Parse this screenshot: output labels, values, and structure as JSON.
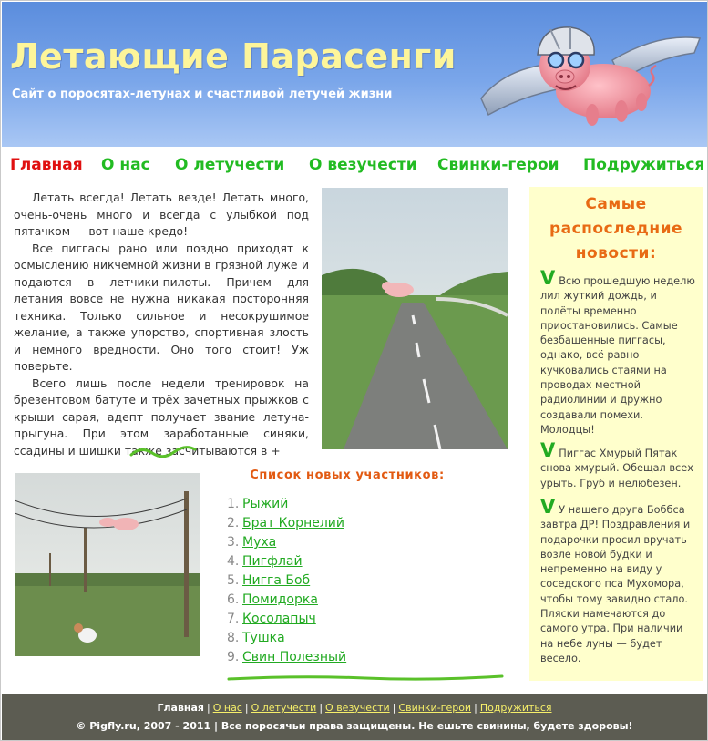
{
  "header": {
    "title": "Летающие Парасенги",
    "subtitle": "Сайт о поросятах-летунах и счастливой летучей жизни"
  },
  "nav": {
    "items": [
      {
        "label": "Главная",
        "active": true
      },
      {
        "label": "О нас",
        "active": false
      },
      {
        "label": "О летучести",
        "active": false
      },
      {
        "label": "О везучести",
        "active": false
      },
      {
        "label": "Свинки-герои",
        "active": false
      },
      {
        "label": "Подружиться",
        "active": false
      }
    ]
  },
  "intro": {
    "paragraphs": [
      "Летать всегда! Летать везде! Летать много, очень-очень много и всегда с улыбкой под пятачком — вот наше кредо!",
      "Все пиггасы рано или поздно приходят к осмыслению никчемной жизни в грязной луже и подаются в летчики-пилоты. Причем для летания вовсе не нужна никакая посторонняя техника. Только сильное и несокрушимое желание, а также упорство, спортивная злость и немного вредности. Оно того стоит! Уж поверьте.",
      "Всего лишь после недели тренировок на брезентовом батуте и трёх зачетных прыжков с крыши сарая, адепт получает звание летуна-прыгуна. При этом заработанные синяки, ссадины и шишки также засчитываются в +"
    ]
  },
  "members": {
    "title": "Список новых участников:",
    "items": [
      {
        "num": "1.",
        "name": "Рыжий"
      },
      {
        "num": "2.",
        "name": "Брат Корнелий"
      },
      {
        "num": "3.",
        "name": "Муха"
      },
      {
        "num": "4.",
        "name": "Пигфлай"
      },
      {
        "num": "5.",
        "name": "Нигга Боб"
      },
      {
        "num": "6.",
        "name": "Помидорка"
      },
      {
        "num": "7.",
        "name": "Косолапыч"
      },
      {
        "num": "8.",
        "name": "Тушка"
      },
      {
        "num": "9.",
        "name": "Свин Полезный"
      }
    ]
  },
  "news": {
    "title": "Самые распоследние новости:",
    "items": [
      {
        "mark": "V",
        "text": "Всю прошедшую неделю лил жуткий дождь, и полёты временно приостановились. Самые безбашенные пиггасы, однако, всё равно кучковались стаями на проводах местной радиолинии и дружно создавали помехи. Молодцы!"
      },
      {
        "mark": "V",
        "text": "Пиггас Хмурый Пятак снова хмурый. Обещал всех урыть. Груб и нелюбезен."
      },
      {
        "mark": "V",
        "text": "У нашего друга Боббса завтра ДР! Поздравления и подарочки просил вручать возле новой будки и непременно на виду у соседского пса Мухомора, чтобы тому завидно стало. Пляски намечаются до самого утра. При наличии на небе луны — будет весело."
      }
    ]
  },
  "footer": {
    "links": [
      {
        "label": "Главная",
        "current": true
      },
      {
        "label": "О нас",
        "current": false
      },
      {
        "label": "О летучести",
        "current": false
      },
      {
        "label": "О везучести",
        "current": false
      },
      {
        "label": "Свинки-герои",
        "current": false
      },
      {
        "label": "Подружиться",
        "current": false
      }
    ],
    "separator": "|",
    "copyright": "© Pigfly.ru, 2007 - 2011 | Все поросячьи права защищены. Не ешьте свинины, будете здоровы!"
  },
  "colors": {
    "header_bg": "#6f9ce6",
    "title": "#fdf59a",
    "nav_link": "#22bb22",
    "nav_active": "#e01010",
    "members_title": "#e25a12",
    "news_bg": "#ffffcc",
    "news_title": "#e86a14",
    "footer_bg": "#5c5c52",
    "footer_link": "#f6ef6a"
  },
  "icons": {
    "logo": "flying-pig-with-helmet-icon",
    "news_mark": "check-v-icon",
    "divider": "squiggle-divider-icon"
  }
}
